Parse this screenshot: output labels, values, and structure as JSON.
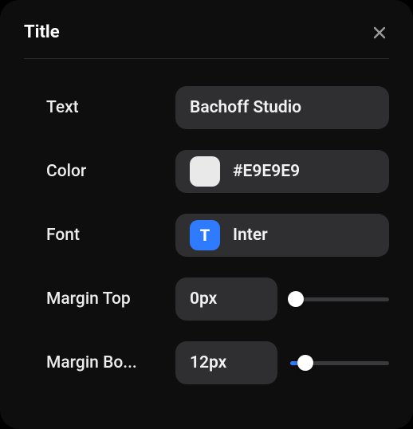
{
  "panel": {
    "title": "Title"
  },
  "fields": {
    "text": {
      "label": "Text",
      "value": "Bachoff Studio"
    },
    "color": {
      "label": "Color",
      "swatch": "#E9E9E9",
      "value": "#E9E9E9"
    },
    "font": {
      "label": "Font",
      "badge": "T",
      "value": "Inter"
    },
    "marginTop": {
      "label": "Margin Top",
      "value": "0px",
      "sliderPercent": 6
    },
    "marginBottom": {
      "label": "Margin Bo...",
      "value": "12px",
      "sliderPercent": 15
    }
  },
  "colors": {
    "accent": "#2f7bff"
  }
}
